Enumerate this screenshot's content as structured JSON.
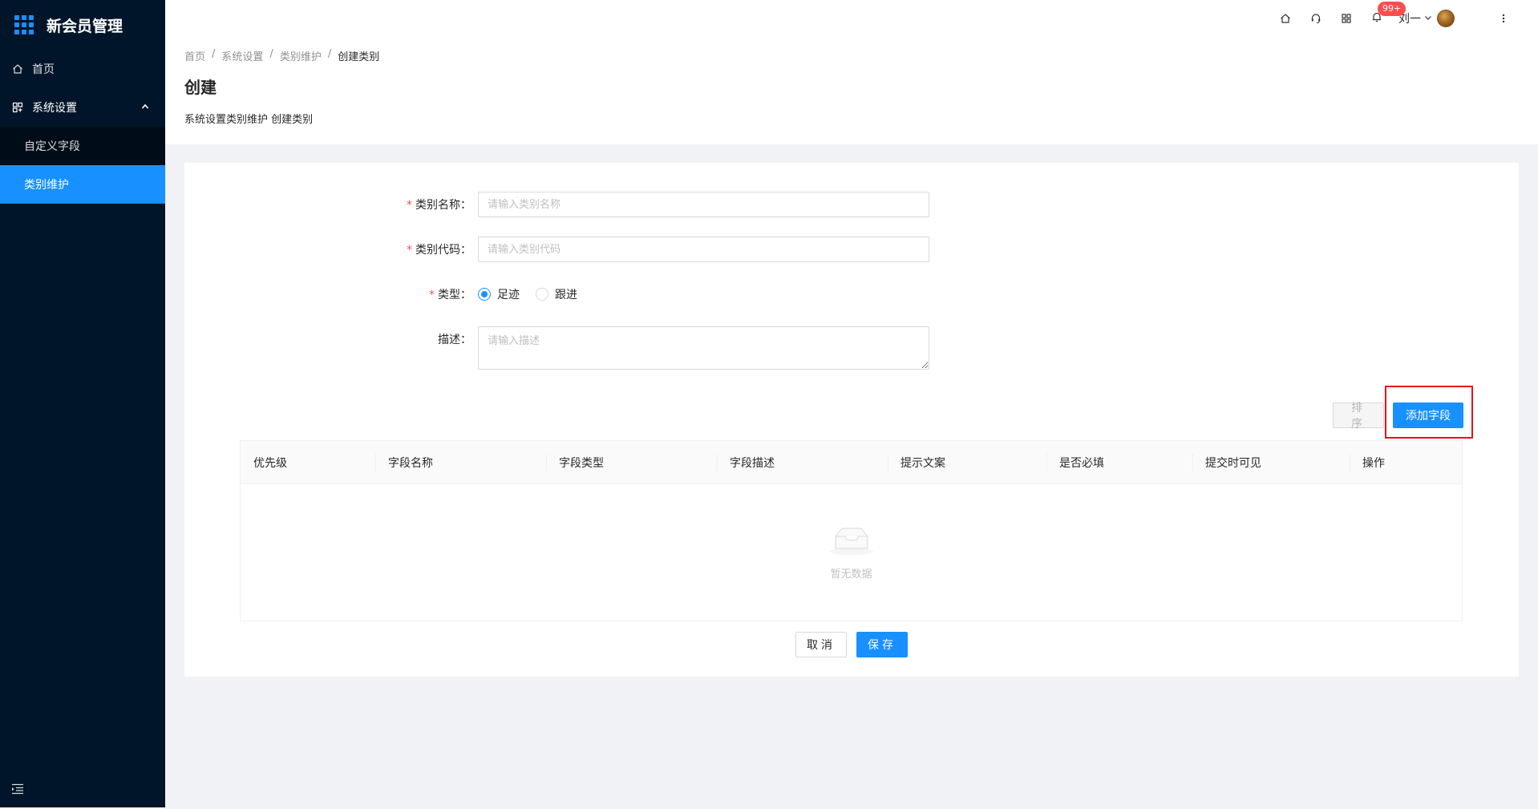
{
  "app": {
    "title": "新会员管理"
  },
  "sidebar": {
    "home": "首页",
    "group": "系统设置",
    "items": [
      {
        "label": "自定义字段"
      },
      {
        "label": "类别维护"
      }
    ]
  },
  "header": {
    "badge": "99+",
    "user": "刘一"
  },
  "breadcrumb": [
    "首页",
    "系统设置",
    "类别维护",
    "创建类别"
  ],
  "page": {
    "title": "创建",
    "description": "系统设置类别维护 创建类别"
  },
  "form": {
    "name_label": "类别名称：",
    "name_placeholder": "请输入类别名称",
    "code_label": "类别代码：",
    "code_placeholder": "请输入类别代码",
    "type_label": "类型：",
    "type_options": [
      "足迹",
      "跟进"
    ],
    "type_selected": "足迹",
    "desc_label": "描述：",
    "desc_placeholder": "请输入描述"
  },
  "table": {
    "sort_button": "排序",
    "add_button": "添加字段",
    "columns": [
      "优先级",
      "字段名称",
      "字段类型",
      "字段描述",
      "提示文案",
      "是否必填",
      "提交时可见",
      "操作"
    ],
    "empty_text": "暂无数据"
  },
  "footer": {
    "cancel": "取消",
    "save": "保存"
  },
  "colors": {
    "primary": "#1890ff",
    "sidebar_bg": "#001529",
    "highlight": "#e8111a",
    "badge": "#ff4d4f"
  }
}
